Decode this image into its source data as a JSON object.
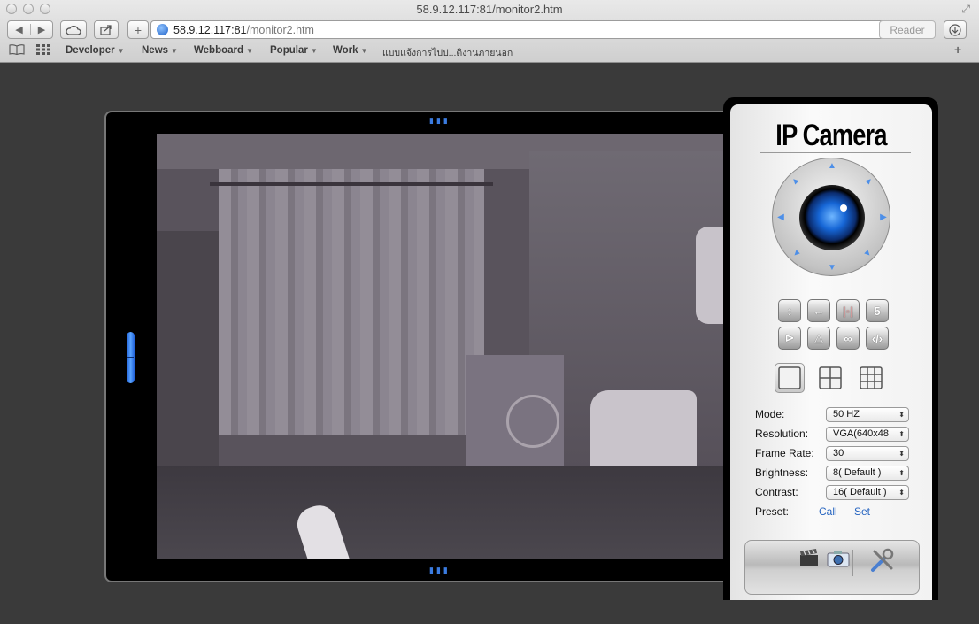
{
  "browser": {
    "window_title": "58.9.12.117:81/monitor2.htm",
    "url_host": "58.9.12.117:81",
    "url_path": "/monitor2.htm",
    "reader_label": "Reader",
    "bookmarks": [
      {
        "label": "Developer",
        "has_menu": true
      },
      {
        "label": "News",
        "has_menu": true
      },
      {
        "label": "Webboard",
        "has_menu": true
      },
      {
        "label": "Popular",
        "has_menu": true
      },
      {
        "label": "Work",
        "has_menu": true
      },
      {
        "label": "แบบแจ้งการไปป...ติงานภายนอก",
        "has_menu": false
      }
    ]
  },
  "camera": {
    "title": "IP Camera",
    "view_buttons_row1": [
      "↕",
      "↔",
      "|◦|",
      "5"
    ],
    "view_buttons_row2": [
      "⊳",
      "△",
      "∞",
      "‹/›"
    ],
    "settings": {
      "mode_label": "Mode:",
      "mode_value": "50 HZ",
      "resolution_label": "Resolution:",
      "resolution_value": "VGA(640x48",
      "frame_rate_label": "Frame Rate:",
      "frame_rate_value": "30",
      "brightness_label": "Brightness:",
      "brightness_value": "8( Default )",
      "contrast_label": "Contrast:",
      "contrast_value": "16( Default )",
      "preset_label": "Preset:",
      "preset_call": "Call",
      "preset_set": "Set"
    }
  }
}
